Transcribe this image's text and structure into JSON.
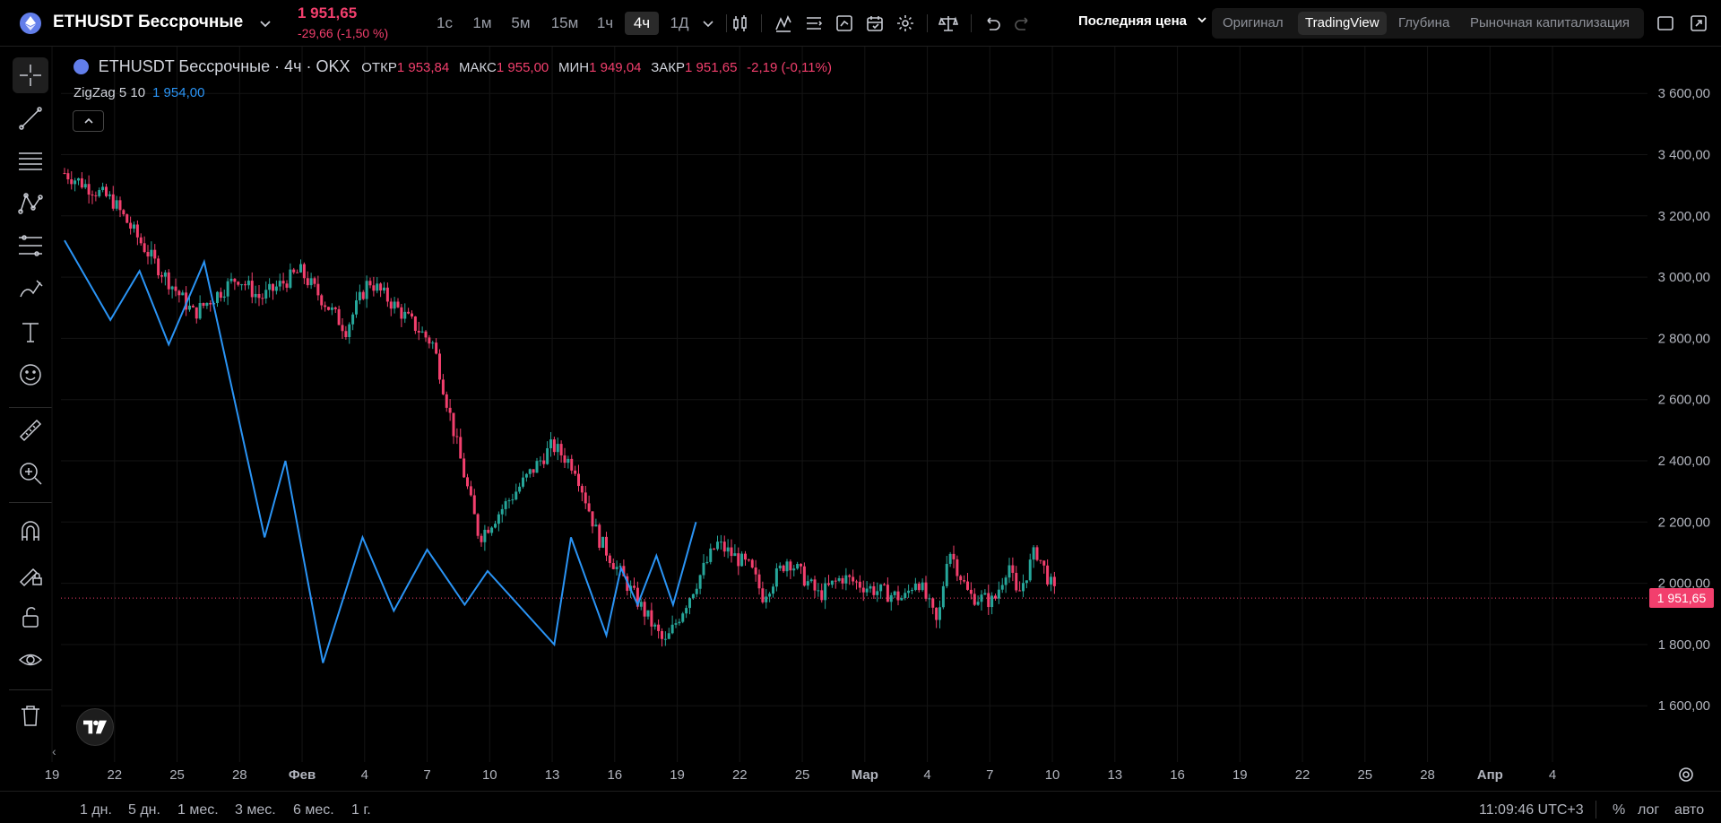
{
  "header": {
    "symbol": "ETHUSDT Бессрочные",
    "price": "1 951,65",
    "change": "-29,66 (-1,50 %)",
    "timeframes": [
      "1с",
      "1м",
      "5м",
      "15м",
      "1ч",
      "4ч",
      "1Д"
    ],
    "active_timeframe": "4ч",
    "price_mode": "Последняя цена",
    "views": [
      "Оригинал",
      "TradingView",
      "Глубина",
      "Рыночная капитализация"
    ],
    "active_view": "TradingView"
  },
  "legend": {
    "title": "ETHUSDT Бессрочные · 4ч · OKX",
    "open_label": "ОТКР",
    "open": "1 953,84",
    "high_label": "МАКС",
    "high": "1 955,00",
    "low_label": "МИН",
    "low": "1 949,04",
    "close_label": "ЗАКР",
    "close": "1 951,65",
    "change": "-2,19 (-0,11%)",
    "indicator": "ZigZag 5 10",
    "indicator_value": "1 954,00"
  },
  "bottom": {
    "ranges": [
      "1 дн.",
      "5 дн.",
      "1 мес.",
      "3 мес.",
      "6 мес.",
      "1 г."
    ],
    "clock": "11:09:46 UTC+3",
    "percent": "%",
    "log": "лог",
    "auto": "авто"
  },
  "colors": {
    "up": "#26a69a",
    "down": "#f23f6d",
    "zigzag": "#2a94f5",
    "bg": "#000000"
  },
  "chart_data": {
    "type": "candlestick",
    "title": "ETHUSDT Бессрочные · 4ч · OKX",
    "y_ticks": [
      3600,
      3400,
      3200,
      3000,
      2800,
      2600,
      2400,
      2200,
      2000,
      1800,
      1600
    ],
    "y_tick_labels": [
      "3 600,00",
      "3 400,00",
      "3 200,00",
      "3 000,00",
      "2 800,00",
      "2 600,00",
      "2 400,00",
      "2 200,00",
      "2 000,00",
      "1 800,00",
      "1 600,00"
    ],
    "ylim": [
      1500,
      3700
    ],
    "x_tick_labels": [
      "19",
      "22",
      "25",
      "28",
      "Фев",
      "4",
      "7",
      "10",
      "13",
      "16",
      "19",
      "22",
      "25",
      "Мар",
      "4",
      "7",
      "10",
      "13",
      "16",
      "19",
      "22",
      "25",
      "28",
      "Апр",
      "4"
    ],
    "last_price": 1951.65,
    "last_price_label": "1 951,65",
    "series": [
      {
        "name": "ETHUSDT",
        "anchor_day_offset": [
          0,
          2.3,
          4.3,
          6.2,
          8.3,
          9.4,
          11.3,
          13.5,
          14.6,
          17.7,
          18.8,
          19.9,
          23.4,
          24.5,
          25.6,
          26.5,
          28.8,
          30.3,
          31.3,
          32.9,
          33.5,
          34.7,
          36.2,
          37.3,
          38.8,
          40.3,
          40.9,
          41.9,
          42.4,
          43.4,
          44.6,
          45.3,
          45.7,
          46.6,
          47.3,
          47.6
        ],
        "anchor_price": [
          3340,
          3250,
          3050,
          2880,
          3000,
          2930,
          3020,
          2830,
          2990,
          2780,
          2460,
          2150,
          2450,
          2380,
          2150,
          2050,
          1800,
          2000,
          2130,
          2050,
          1960,
          2080,
          1960,
          2020,
          1980,
          1950,
          2020,
          1860,
          2120,
          1960,
          1940,
          2070,
          1950,
          2110,
          2000,
          1952
        ]
      },
      {
        "name": "ZigZag",
        "day_offset": [
          0,
          2.2,
          3.6,
          5.0,
          6.7,
          9.6,
          10.6,
          12.4,
          14.3,
          15.8,
          17.4,
          19.2,
          20.3,
          23.5,
          24.3,
          26.0,
          26.7,
          27.5,
          28.4,
          29.2,
          30.3
        ],
        "values": [
          3120,
          2860,
          3020,
          2780,
          3050,
          2150,
          2400,
          1740,
          2150,
          1910,
          2110,
          1930,
          2040,
          1800,
          2150,
          1830,
          2050,
          1930,
          2090,
          1930,
          2200,
          1960
        ]
      }
    ]
  }
}
